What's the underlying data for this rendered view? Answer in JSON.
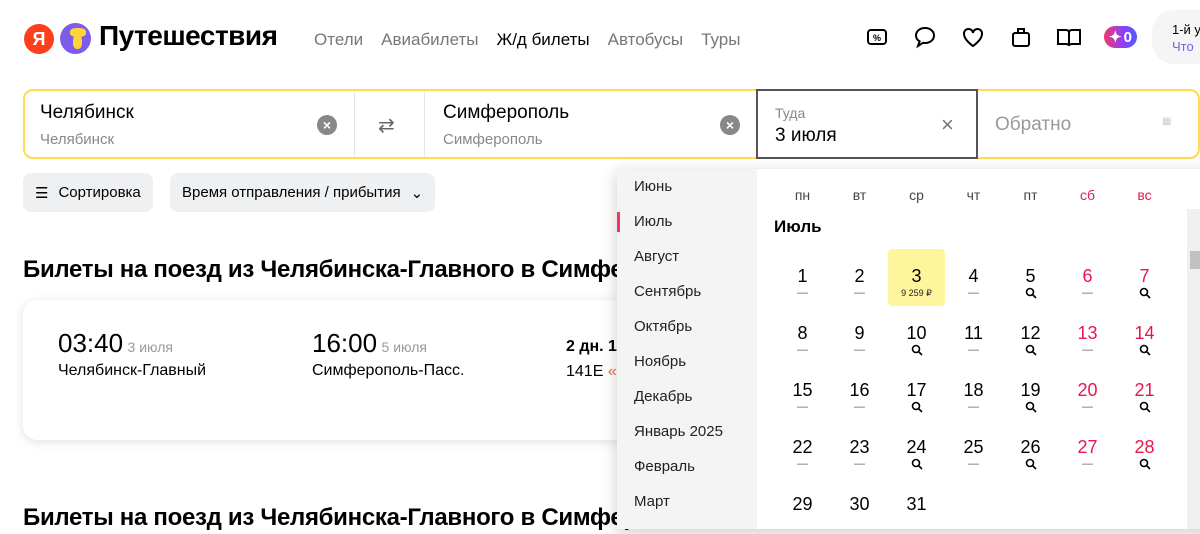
{
  "header": {
    "logo_letter": "Я",
    "brand": "Путешествия",
    "nav": [
      "Отели",
      "Авиабилеты",
      "Ж/д билеты",
      "Автобусы",
      "Туры"
    ],
    "active_nav": 2,
    "plus_count": "0",
    "user_line1": "1-й у",
    "user_line2": "Что"
  },
  "search": {
    "from": "Челябинск",
    "from_sub": "Челябинск",
    "to": "Симферополь",
    "to_sub": "Симферополь",
    "there_label": "Туда",
    "there_value": "3 июля",
    "back_placeholder": "Обратно"
  },
  "filters": {
    "sort": "Сортировка",
    "time": "Время отправления / прибытия"
  },
  "results": {
    "heading": "Билеты на поезд из Челябинска-Главного в Симферополь",
    "heading2": "Билеты на поезд из Челябинска-Главного в Симферополь",
    "card": {
      "dep_time": "03:40",
      "dep_date": "3 июля",
      "dep_station": "Челябинск-Главный",
      "arr_time": "16:00",
      "arr_date": "5 июля",
      "arr_station": "Симферополь-Пасс.",
      "duration": "2 дн. 1",
      "train": "141Е",
      "train_name": "«"
    }
  },
  "calendar": {
    "months": [
      "Июнь",
      "Июль",
      "Август",
      "Сентябрь",
      "Октябрь",
      "Ноябрь",
      "Декабрь",
      "Январь 2025",
      "Февраль",
      "Март"
    ],
    "selected_month": 1,
    "weekdays": [
      "пн",
      "вт",
      "ср",
      "чт",
      "пт",
      "сб",
      "вс"
    ],
    "month_title": "Июль",
    "days": [
      {
        "d": "1",
        "m": "—"
      },
      {
        "d": "2",
        "m": "—"
      },
      {
        "d": "3",
        "m": "9 259 ₽",
        "sel": true
      },
      {
        "d": "4",
        "m": "—"
      },
      {
        "d": "5",
        "m": "search"
      },
      {
        "d": "6",
        "m": "—"
      },
      {
        "d": "7",
        "m": "search"
      },
      {
        "d": "8",
        "m": "—"
      },
      {
        "d": "9",
        "m": "—"
      },
      {
        "d": "10",
        "m": "search"
      },
      {
        "d": "11",
        "m": "—"
      },
      {
        "d": "12",
        "m": "search"
      },
      {
        "d": "13",
        "m": "—"
      },
      {
        "d": "14",
        "m": "search"
      },
      {
        "d": "15",
        "m": "—"
      },
      {
        "d": "16",
        "m": "—"
      },
      {
        "d": "17",
        "m": "search"
      },
      {
        "d": "18",
        "m": "—"
      },
      {
        "d": "19",
        "m": "search"
      },
      {
        "d": "20",
        "m": "—"
      },
      {
        "d": "21",
        "m": "search"
      },
      {
        "d": "22",
        "m": "—"
      },
      {
        "d": "23",
        "m": "—"
      },
      {
        "d": "24",
        "m": "search"
      },
      {
        "d": "25",
        "m": "—"
      },
      {
        "d": "26",
        "m": "search"
      },
      {
        "d": "27",
        "m": "—"
      },
      {
        "d": "28",
        "m": "search"
      },
      {
        "d": "29",
        "m": ""
      },
      {
        "d": "30",
        "m": ""
      },
      {
        "d": "31",
        "m": ""
      }
    ]
  },
  "colors": {
    "accent": "#ffdb4d",
    "weekend": "#e6174f",
    "selected_day": "#fff59d"
  }
}
